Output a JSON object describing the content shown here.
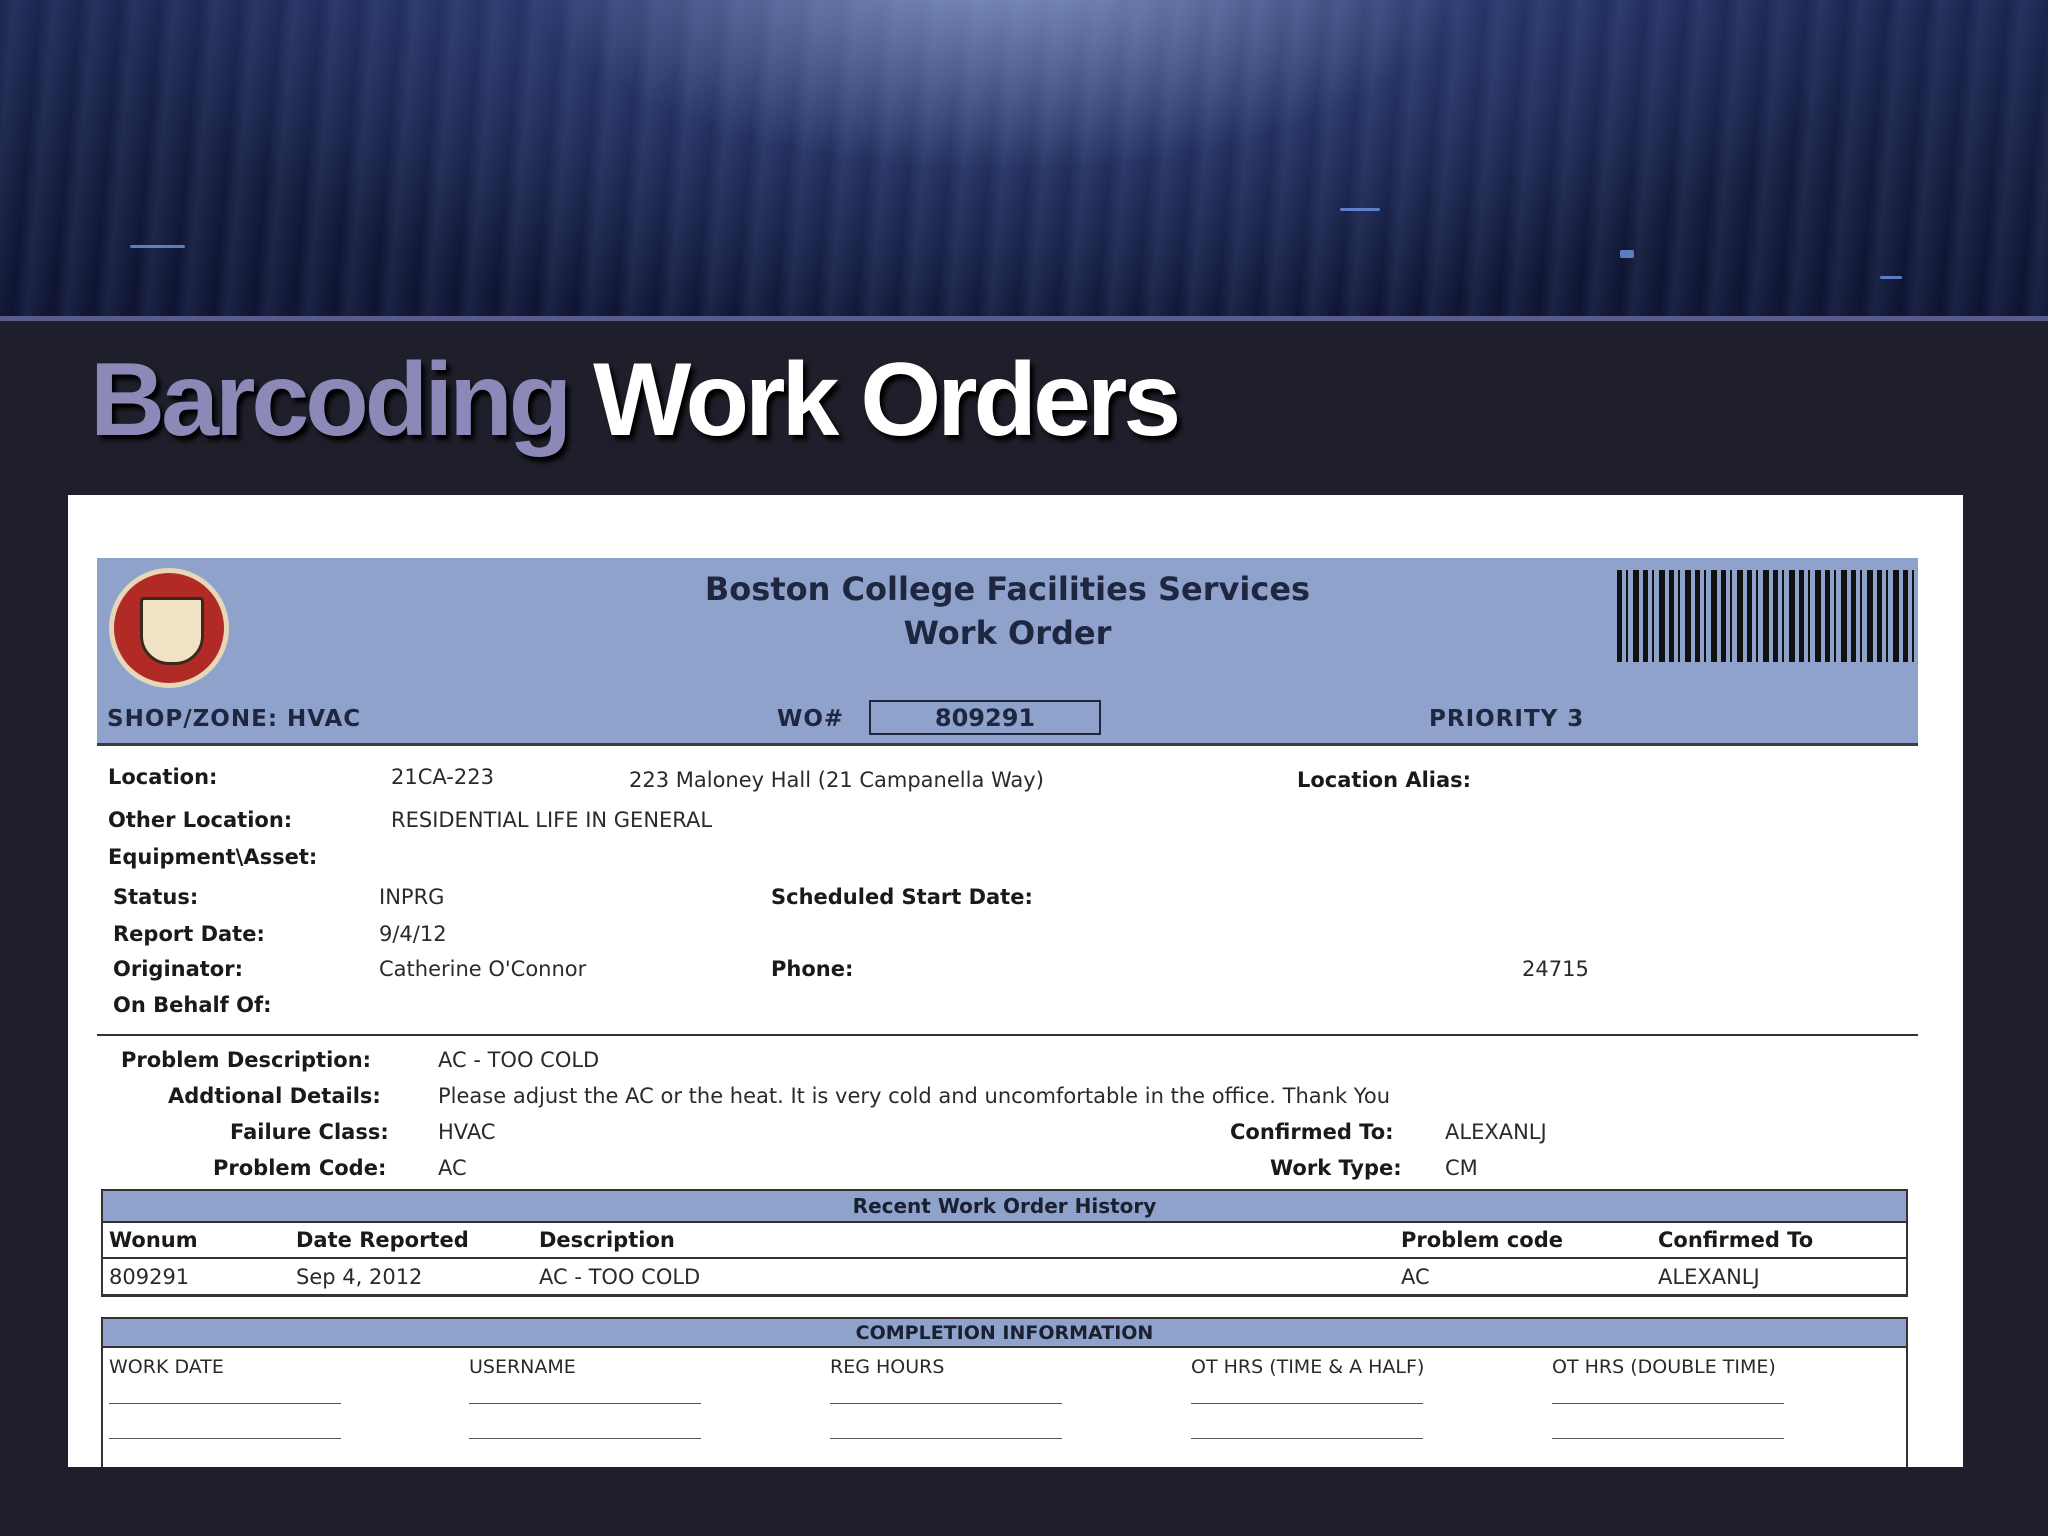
{
  "slide": {
    "title_part1": "Barcoding",
    "title_part2": "Work Orders"
  },
  "work_order": {
    "org": "Boston College Facilities Services",
    "doc_type": "Work Order",
    "shop_zone": "SHOP/ZONE: HVAC",
    "wo_label": "WO#",
    "wo_number": "809291",
    "priority": "PRIORITY 3",
    "fields": {
      "location_label": "Location:",
      "location_code": "21CA-223",
      "location_desc": "223  Maloney Hall (21 Campanella Way)",
      "location_alias_label": "Location Alias:",
      "other_location_label": "Other Location:",
      "other_location": "RESIDENTIAL LIFE IN GENERAL",
      "equipment_label": "Equipment\\Asset:",
      "status_label": "Status:",
      "status": "INPRG",
      "scheduled_start_label": "Scheduled Start Date:",
      "report_date_label": "Report Date:",
      "report_date": "9/4/12",
      "originator_label": "Originator:",
      "originator": "Catherine O'Connor",
      "phone_label": "Phone:",
      "phone": "24715",
      "on_behalf_label": "On Behalf Of:"
    },
    "problem": {
      "description_label": "Problem Description:",
      "description": "AC  - TOO COLD",
      "details_label": "Addtional Details:",
      "details": "Please adjust the AC or the heat.  It is very cold and uncomfortable in the office.  Thank You",
      "failure_class_label": "Failure Class:",
      "failure_class": "HVAC",
      "confirmed_label": "Confirmed To:",
      "confirmed": "ALEXANLJ",
      "problem_code_label": "Problem Code:",
      "problem_code": "AC",
      "work_type_label": "Work Type:",
      "work_type": "CM"
    },
    "history": {
      "title": "Recent Work Order History",
      "columns": [
        "Wonum",
        "Date Reported",
        "Description",
        "Problem code",
        "Confirmed To"
      ],
      "row": [
        "809291",
        "Sep 4, 2012",
        "AC  - TOO COLD",
        "AC",
        "ALEXANLJ"
      ]
    },
    "completion": {
      "title": "COMPLETION INFORMATION",
      "columns": [
        "WORK DATE",
        "USERNAME",
        "REG HOURS",
        "OT HRS (TIME & A  HALF)",
        "OT HRS (DOUBLE TIME)"
      ]
    }
  }
}
